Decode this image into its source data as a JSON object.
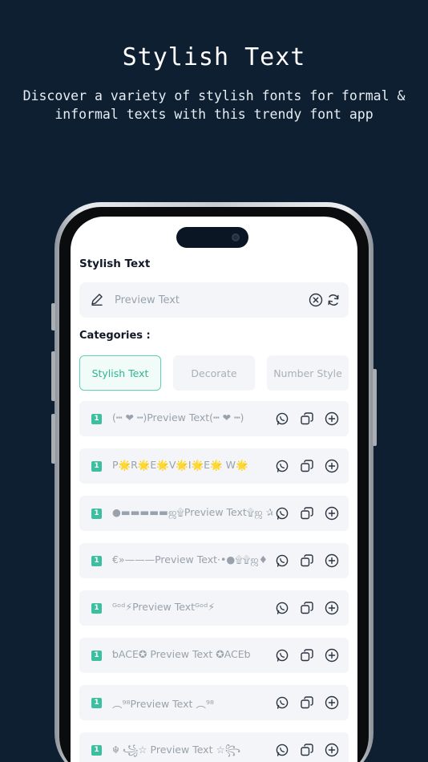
{
  "hero": {
    "title": "Stylish Text",
    "subtitle": "Discover a variety of stylish fonts for formal & informal texts with this trendy font app"
  },
  "app": {
    "title": "Stylish Text",
    "search": {
      "placeholder": "Preview Text"
    },
    "categories_label": "Categories :",
    "tabs": [
      {
        "label": "Stylish Text",
        "active": true
      },
      {
        "label": "Decorate",
        "active": false
      },
      {
        "label": "Number Style",
        "active": false
      }
    ],
    "styles": [
      {
        "badge": "1",
        "preview": "(┅ ❤ ┅)Preview Text(┅ ❤ ┅)"
      },
      {
        "badge": "1",
        "preview": "P🌟R🌟E🌟V🌟I🌟E🌟 W🌟"
      },
      {
        "badge": "1",
        "preview": "●▬▬▬▬▬ஜ۩Preview Text۩ஜ ✰"
      },
      {
        "badge": "1",
        "preview": "€»———Preview Text·•●۩۩ஜ♦"
      },
      {
        "badge": "1",
        "preview": "ᴳᵒᵈ⚡Preview Textᴳᵒᵈ⚡"
      },
      {
        "badge": "1",
        "preview": "ƅACE✪ Preview Text ✪ACEƅ"
      },
      {
        "badge": "1",
        "preview": "︵⁹⁸Preview Text ︵⁹⁸"
      },
      {
        "badge": "1",
        "preview": "☬ ꧁☆ Preview Text ☆꧂"
      }
    ]
  },
  "colors": {
    "background": "#0e1f31",
    "accent": "#3cbfa0",
    "row_bg": "#f3f5f8"
  },
  "icons": [
    "pencil-icon",
    "clear-icon",
    "refresh-icon",
    "whatsapp-icon",
    "copy-icon",
    "add-icon"
  ]
}
